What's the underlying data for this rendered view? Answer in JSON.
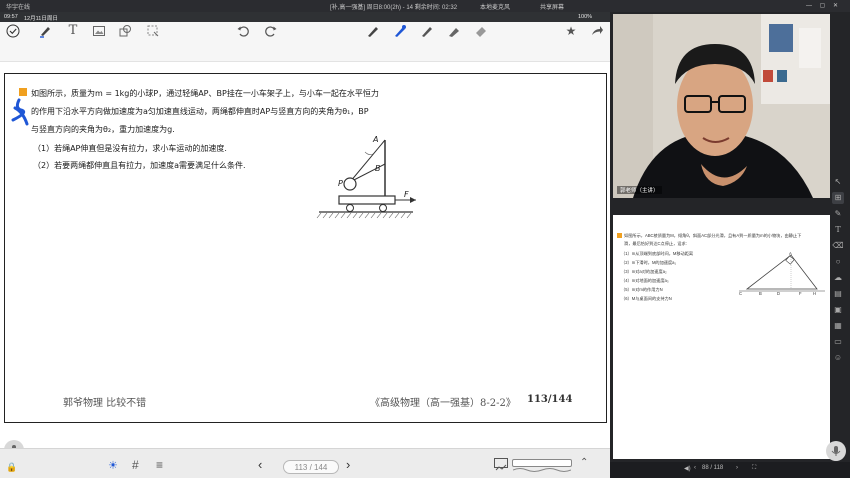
{
  "titlebar": {
    "app_name": "华宇在线",
    "center_title": "[补,高一强基] 周日8:00(2h) - 14   剩余时间: 02:32",
    "mic_label": "本地麦克风",
    "share_label": "共享屏幕",
    "window_controls": "— ▢ ✕"
  },
  "ipad_status": {
    "time": "09:57",
    "date": "12月11日周日",
    "battery": "100%"
  },
  "question": {
    "line1": "如图所示，质量为m = 1kg的小球P，通过轻绳AP、BP挂在一小车架子上，与小车一起在水平恒力",
    "line2": "的作用下沿水平方向做加速度为a匀加速直线运动，两绳都伸直时AP与竖直方向的夹角为θ₁，BP",
    "line3": "与竖直方向的夹角为θ₂，重力加速度为g.",
    "item1": "（1）若绳AP伸直但是没有拉力，求小车运动的加速度.",
    "item2": "（2）若要两绳都伸直且有拉力，加速度a需要满足什么条件."
  },
  "figure_labels": {
    "A": "A",
    "B": "B",
    "P": "P",
    "F": "F"
  },
  "page_footer": {
    "left": "郭爷物理  比较不错",
    "right": "《高级物理（高一强基）8-2-2》",
    "page": "113/144"
  },
  "bottom": {
    "pager": "113 / 144"
  },
  "video": {
    "name_tag": "郭老师（主讲）"
  },
  "thumbnail": {
    "line1": "如图所示，ABC棱质量为M，倾角θ，斜面AC部分光滑，且有A到一质量为m的小物块，由静止下",
    "line2": "滑，最后恰好到达C点停止，设求:",
    "items": [
      "（1）m从顶端到底部时间，M移动距离",
      "（2）m下滑时，M的加速度a₁",
      "（3）m对a对的加速度a₂",
      "（4）m对地面的加速度a₃",
      "（5）m对m的作用力N",
      "（6）M与桌面间的支持力N"
    ],
    "fig_labels": [
      "A",
      "C",
      "B",
      "D",
      "F",
      "H"
    ]
  },
  "rightbar": {
    "pages": "88 / 118"
  },
  "colors": {
    "accent_blue": "#1f57d6",
    "marker_orange": "#f0a020",
    "page_border": "#222222"
  }
}
